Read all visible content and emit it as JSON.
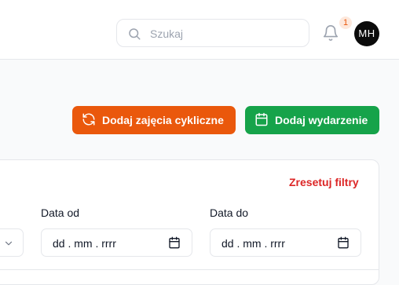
{
  "header": {
    "search_placeholder": "Szukaj",
    "notification_count": "1",
    "avatar_initials": "MH"
  },
  "actions": {
    "cyclic_label": "Dodaj zajęcia cykliczne",
    "event_label": "Dodaj wydarzenie"
  },
  "filters": {
    "reset_label": "Zresetuj filtry",
    "date_from_label": "Data od",
    "date_from_value": "dd . mm . rrrr",
    "date_to_label": "Data do",
    "date_to_value": "dd . mm . rrrr"
  },
  "colors": {
    "primary_orange": "#ea580c",
    "success_green": "#16a34a",
    "danger_red": "#dc2626"
  },
  "icons": [
    "search-icon",
    "bell-icon",
    "refresh-icon",
    "calendar-icon",
    "chevron-down-icon"
  ]
}
